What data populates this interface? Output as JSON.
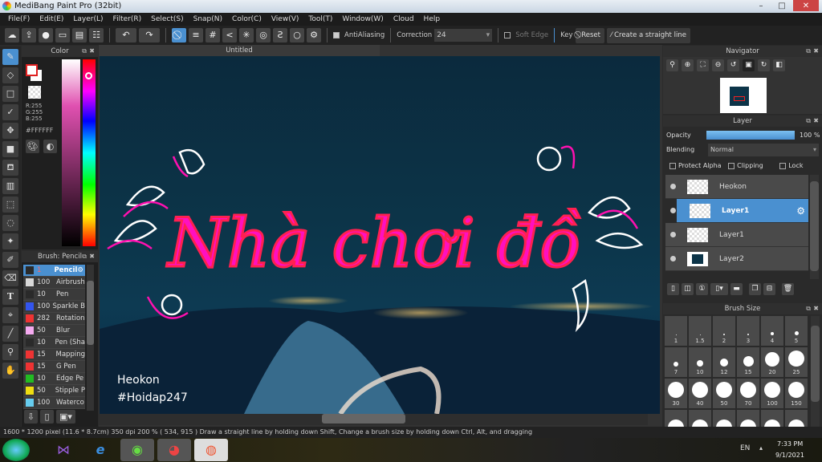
{
  "window": {
    "title": "MediBang Paint Pro (32bit)",
    "minimize": "–",
    "maximize": "□",
    "close": "✕"
  },
  "menu": [
    "File(F)",
    "Edit(E)",
    "Layer(L)",
    "Filter(R)",
    "Select(S)",
    "Snap(N)",
    "Color(C)",
    "View(V)",
    "Tool(T)",
    "Window(W)",
    "Cloud",
    "Help"
  ],
  "toolbar": {
    "antialiasing": "AntiAliasing",
    "correction_label": "Correction",
    "correction_value": "24",
    "soft_edge": "Soft Edge",
    "key_label": "Key",
    "reset": "Reset",
    "straight_line": "Create a straight line"
  },
  "color_panel": {
    "title": "Color",
    "r": "R:255",
    "g": "G:255",
    "b": "B:255",
    "hex": "#FFFFFF",
    "primary": "#ffffff",
    "accent": "#e02020"
  },
  "brush_panel": {
    "title": "Brush: Pencil",
    "items": [
      {
        "size": "1",
        "name": "Pencil",
        "color": "#2a2a2a"
      },
      {
        "size": "100",
        "name": "Airbrush",
        "color": "#d8d8d8"
      },
      {
        "size": "10",
        "name": "Pen",
        "color": "#2a2a2a"
      },
      {
        "size": "100",
        "name": "Sparkle B",
        "color": "#3355ee"
      },
      {
        "size": "282",
        "name": "Rotation",
        "color": "#ee3333"
      },
      {
        "size": "50",
        "name": "Blur",
        "color": "#f5aaf0"
      },
      {
        "size": "10",
        "name": "Pen (Sha",
        "color": "#2a2a2a"
      },
      {
        "size": "15",
        "name": "Mapping",
        "color": "#ee3333"
      },
      {
        "size": "15",
        "name": "G Pen",
        "color": "#ee3333"
      },
      {
        "size": "10",
        "name": "Edge Pe",
        "color": "#22bb22"
      },
      {
        "size": "50",
        "name": "Stipple P",
        "color": "#eedd11"
      },
      {
        "size": "100",
        "name": "Waterco",
        "color": "#66ccee"
      }
    ]
  },
  "canvas": {
    "tab": "Untitled",
    "lettering": "Nhà chơi đồ",
    "signature_name": "Heokon",
    "signature_tag": "#Hoidap247"
  },
  "navigator": {
    "title": "Navigator"
  },
  "layer_panel": {
    "title": "Layer",
    "opacity_label": "Opacity",
    "opacity_value": "100 %",
    "opacity": 100,
    "blending_label": "Blending",
    "blending_value": "Normal",
    "protect_alpha": "Protect Alpha",
    "clipping": "Clipping",
    "lock": "Lock",
    "layers": [
      {
        "name": "Heokon",
        "selected": false
      },
      {
        "name": "Layer1",
        "selected": true
      },
      {
        "name": "Layer1",
        "selected": false
      },
      {
        "name": "Layer2",
        "selected": false
      }
    ]
  },
  "brush_size": {
    "title": "Brush Size",
    "sizes": [
      "1",
      "1.5",
      "2",
      "3",
      "4",
      "5",
      "7",
      "10",
      "12",
      "15",
      "20",
      "25",
      "30",
      "40",
      "50",
      "70",
      "100",
      "150",
      "",
      "",
      "",
      "",
      "",
      ""
    ]
  },
  "status": {
    "text": "1600 * 1200 pixel  (11.6 * 8.7cm)  350 dpi  200 %  ( 534, 915 )  Draw a straight line by holding down Shift, Change a brush size by holding down Ctrl, Alt, and dragging"
  },
  "taskbar": {
    "lang": "EN",
    "time": "7:33 PM",
    "date": "9/1/2021"
  }
}
